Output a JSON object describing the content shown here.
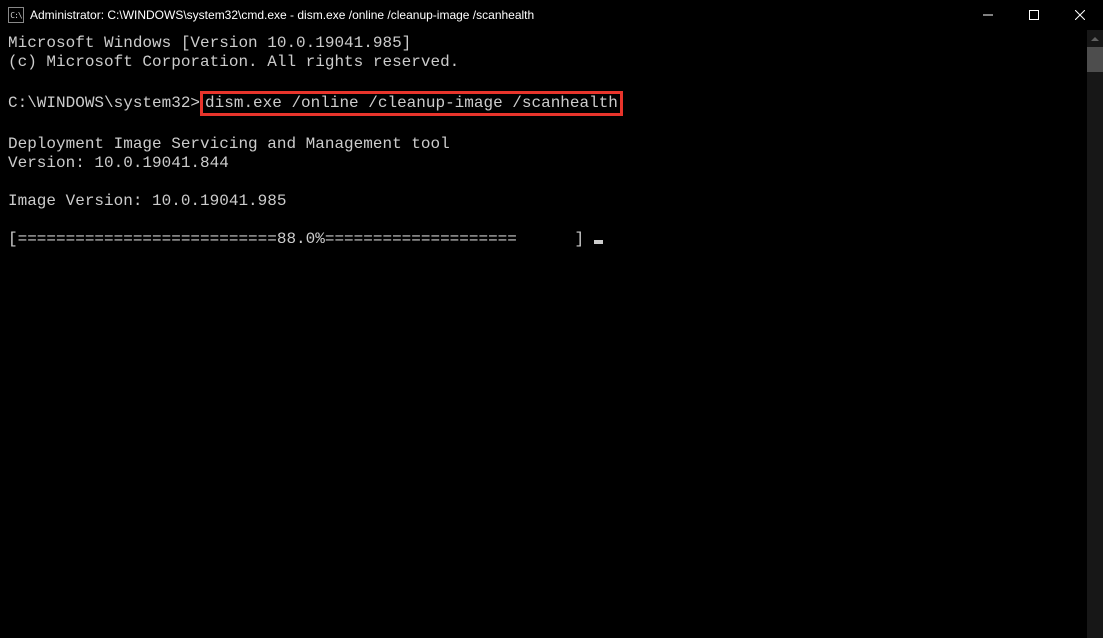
{
  "titlebar": {
    "icon_text": "C:\\",
    "title": "Administrator: C:\\WINDOWS\\system32\\cmd.exe - dism.exe  /online /cleanup-image /scanhealth"
  },
  "terminal": {
    "line1": "Microsoft Windows [Version 10.0.19041.985]",
    "line2": "(c) Microsoft Corporation. All rights reserved.",
    "blank1": "",
    "prompt_prefix": "C:\\WINDOWS\\system32>",
    "command": "dism.exe /online /cleanup-image /scanhealth",
    "blank2": "",
    "tool_line1": "Deployment Image Servicing and Management tool",
    "tool_line2": "Version: 10.0.19041.844",
    "blank3": "",
    "image_version": "Image Version: 10.0.19041.985",
    "blank4": "",
    "progress": "[===========================88.0%====================      ] "
  }
}
